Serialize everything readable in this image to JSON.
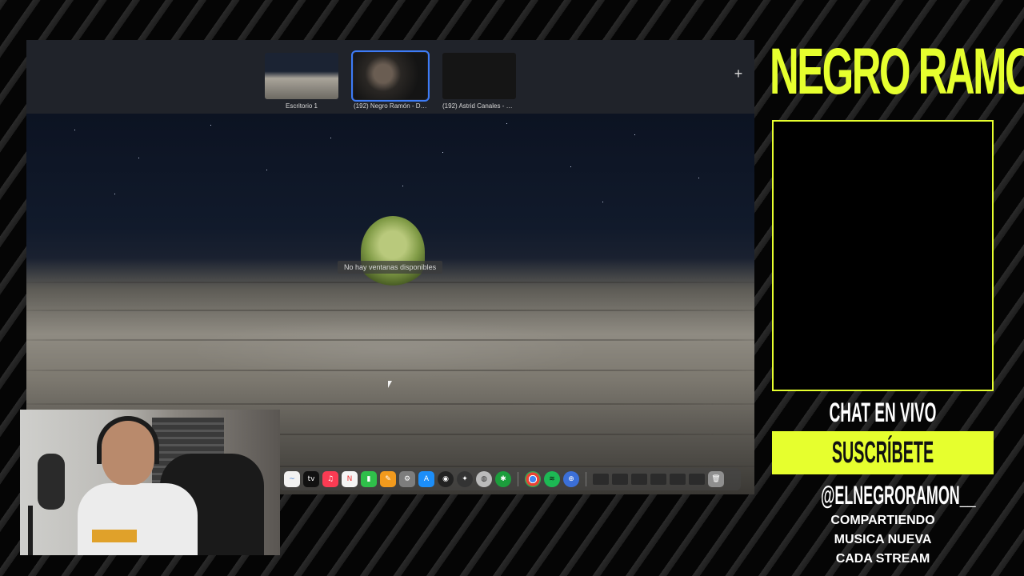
{
  "mission_control": {
    "spaces": [
      {
        "label": "Escritorio 1",
        "active": false
      },
      {
        "label": "(192) Negro Ramón - Di...",
        "active": true
      },
      {
        "label": "(192) Astrid Canales - C...",
        "active": false
      }
    ],
    "add_space_label": "+",
    "no_windows_message": "No hay ventanas disponibles"
  },
  "dock": {
    "apps": [
      "Freeform",
      "Apple TV",
      "Music",
      "News",
      "Numbers",
      "Pages",
      "System Settings",
      "App Store",
      "Logic Pro",
      "Final Cut",
      "Compressor",
      "Bluetooth",
      "Chrome",
      "Spotify",
      "Safari"
    ],
    "apple_tv_label": "tv"
  },
  "overlay": {
    "brand_title": "NEGRO RAMON",
    "chat_label": "CHAT EN VIVO",
    "subscribe_label": "SUSCRÍBETE",
    "handle": "@ELNEGRORAMON__",
    "tagline": [
      "COMPARTIENDO",
      "MUSICA NUEVA",
      "CADA STREAM"
    ]
  },
  "colors": {
    "accent": "#e6ff2e",
    "active_space_outline": "#3d7bf6"
  }
}
